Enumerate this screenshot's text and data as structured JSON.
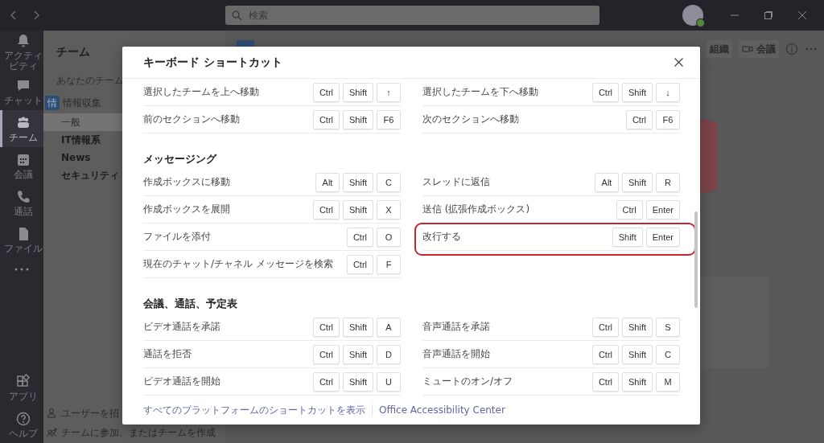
{
  "title_bar": {
    "search": {
      "placeholder": "検索"
    }
  },
  "rail": {
    "items": [
      {
        "label": "アクティビティ",
        "selected": false
      },
      {
        "label": "チャット",
        "selected": false
      },
      {
        "label": "チーム",
        "selected": true
      },
      {
        "label": "会議",
        "selected": false
      },
      {
        "label": "通話",
        "selected": false
      },
      {
        "label": "ファイル",
        "selected": false
      }
    ],
    "bottom_items": [
      {
        "label": "アプリ"
      },
      {
        "label": "ヘルプ"
      }
    ]
  },
  "team_panel": {
    "title": "チーム",
    "section_label": "あなたのチーム",
    "teams": [
      {
        "name": "情報収集",
        "avatar": "情",
        "channels": [
          {
            "name": "一般",
            "selected": true
          }
        ]
      },
      {
        "name": "IT情報系"
      },
      {
        "name": "News"
      },
      {
        "name": "セキュリティ"
      }
    ],
    "footer": [
      "ユーザーを招",
      "チームに参加、またはチームを作成"
    ]
  },
  "main": {
    "header_buttons": [
      {
        "label": "組織"
      },
      {
        "label": "会議"
      }
    ]
  },
  "modal": {
    "title": "キーボード ショートカット",
    "sections": [
      {
        "left": [
          {
            "label": "選択したチームを上へ移動",
            "keys": [
              "Ctrl",
              "Shift",
              "↑"
            ]
          },
          {
            "label": "前のセクションへ移動",
            "keys": [
              "Ctrl",
              "Shift",
              "F6"
            ]
          }
        ],
        "right": [
          {
            "label": "選択したチームを下へ移動",
            "keys": [
              "Ctrl",
              "Shift",
              "↓"
            ]
          },
          {
            "label": "次のセクションへ移動",
            "keys": [
              "Ctrl",
              "F6"
            ]
          }
        ]
      },
      {
        "heading": "メッセージング",
        "left": [
          {
            "label": "作成ボックスに移動",
            "keys": [
              "Alt",
              "Shift",
              "C"
            ]
          },
          {
            "label": "作成ボックスを展開",
            "keys": [
              "Ctrl",
              "Shift",
              "X"
            ]
          },
          {
            "label": "ファイルを添付",
            "keys": [
              "Ctrl",
              "O"
            ]
          },
          {
            "label": "現在のチャット/チャネル メッセージを検索",
            "keys": [
              "Ctrl",
              "F"
            ]
          }
        ],
        "right": [
          {
            "label": "スレッドに返信",
            "keys": [
              "Alt",
              "Shift",
              "R"
            ]
          },
          {
            "label": "送信 (拡張作成ボックス)",
            "keys": [
              "Ctrl",
              "Enter"
            ]
          },
          {
            "label": "改行する",
            "keys": [
              "Shift",
              "Enter"
            ],
            "highlighted": true
          }
        ]
      },
      {
        "heading": "会議、通話、予定表",
        "left": [
          {
            "label": "ビデオ通話を承諾",
            "keys": [
              "Ctrl",
              "Shift",
              "A"
            ]
          },
          {
            "label": "通話を拒否",
            "keys": [
              "Ctrl",
              "Shift",
              "D"
            ]
          },
          {
            "label": "ビデオ通話を開始",
            "keys": [
              "Ctrl",
              "Shift",
              "U"
            ]
          }
        ],
        "right": [
          {
            "label": "音声通話を承諾",
            "keys": [
              "Ctrl",
              "Shift",
              "S"
            ]
          },
          {
            "label": "音声通話を開始",
            "keys": [
              "Ctrl",
              "Shift",
              "C"
            ]
          },
          {
            "label": "ミュートのオン/オフ",
            "keys": [
              "Ctrl",
              "Shift",
              "M"
            ]
          }
        ]
      }
    ],
    "links": [
      "すべてのプラットフォームのショートカットを表示",
      "Office Accessibility Center"
    ]
  }
}
